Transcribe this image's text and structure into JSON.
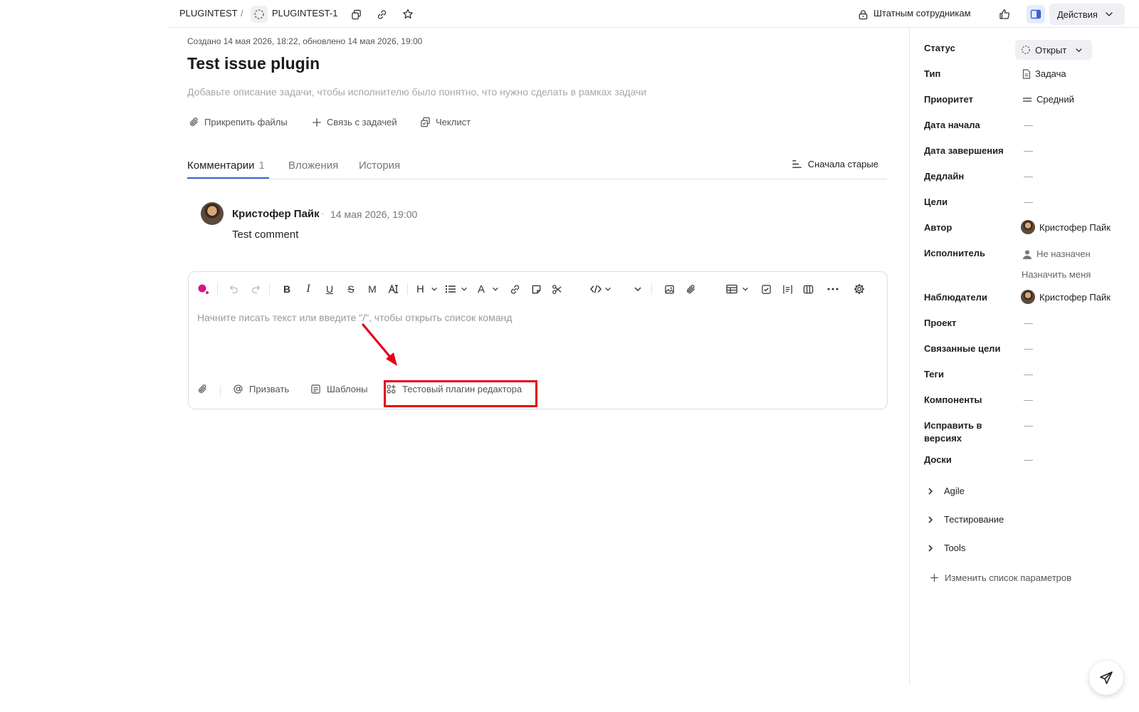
{
  "breadcrumb": {
    "project": "PLUGINTEST",
    "separator": "/",
    "issue_key": "PLUGINTEST-1"
  },
  "topbar": {
    "access": "Штатным сотрудникам",
    "actions": "Действия"
  },
  "issue": {
    "meta": "Создано 14 мая 2026, 18:22, обновлено 14 мая 2026, 19:00",
    "title": "Test issue plugin",
    "description_placeholder": "Добавьте описание задачи, чтобы исполнителю было понятно, что нужно сделать в рамках задачи"
  },
  "actions": {
    "attach": "Прикрепить файлы",
    "link": "Связь с задачей",
    "checklist": "Чеклист"
  },
  "tabs": {
    "comments": "Комментарии",
    "comments_count": "1",
    "attachments": "Вложения",
    "history": "История",
    "sort": "Сначала старые"
  },
  "comment": {
    "author": "Кристофер Пайк",
    "dot": "·",
    "date": "14 мая 2026, 19:00",
    "text": "Test comment"
  },
  "editor": {
    "placeholder": "Начните писать текст или введите \"/\", чтобы открыть список команд",
    "summon": "Призвать",
    "templates": "Шаблоны",
    "plugin": "Тестовый плагин редактора"
  },
  "properties": {
    "status_label": "Статус",
    "status_value": "Открыт",
    "type_label": "Тип",
    "type_value": "Задача",
    "priority_label": "Приоритет",
    "priority_value": "Средний",
    "start_label": "Дата начала",
    "end_label": "Дата завершения",
    "deadline_label": "Дедлайн",
    "goals_label": "Цели",
    "author_label": "Автор",
    "author_value": "Кристофер Пайк",
    "assignee_label": "Исполнитель",
    "assignee_value": "Не назначен",
    "assign_me": "Назначить меня",
    "watchers_label": "Наблюдатели",
    "watchers_value": "Кристофер Пайк",
    "project_label": "Проект",
    "linked_goals_label": "Связанные цели",
    "tags_label": "Теги",
    "components_label": "Компоненты",
    "fix_versions_label_1": "Исправить в",
    "fix_versions_label_2": "версиях",
    "boards_label": "Доски",
    "empty": "—"
  },
  "sections": {
    "agile": "Agile",
    "testing": "Тестирование",
    "tools": "Tools",
    "edit_params": "Изменить список параметров"
  },
  "colors": {
    "accent": "#3b63d8",
    "highlight": "#e4001b",
    "magenta": "#d4148c"
  }
}
